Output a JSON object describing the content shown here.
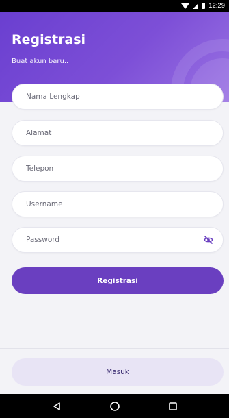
{
  "status_bar": {
    "time": "12:29"
  },
  "header": {
    "title": "Registrasi",
    "subtitle": "Buat akun baru.."
  },
  "form": {
    "fields": [
      {
        "placeholder": "Nama Lengkap",
        "value": ""
      },
      {
        "placeholder": "Alamat",
        "value": ""
      },
      {
        "placeholder": "Telepon",
        "value": ""
      },
      {
        "placeholder": "Username",
        "value": ""
      },
      {
        "placeholder": "Password",
        "value": ""
      }
    ],
    "password_toggle_icon": "eye-slash-icon"
  },
  "actions": {
    "register_label": "Registrasi",
    "login_label": "Masuk"
  },
  "colors": {
    "primary": "#6a3fc0",
    "header_gradient_start": "#6a3fd0",
    "header_gradient_end": "#9a73e3",
    "secondary_button_bg": "#e8e4f5"
  },
  "nav": {
    "back_icon": "back-triangle-icon",
    "home_icon": "home-circle-icon",
    "recents_icon": "recents-square-icon"
  }
}
